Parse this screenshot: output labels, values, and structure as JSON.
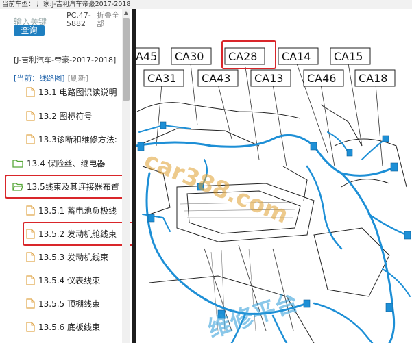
{
  "header": {
    "breadcrumb": "当前车型： 厂家:J-吉利汽车帝豪2017-2018"
  },
  "search": {
    "placeholder": "输入关键",
    "button_label": "查询"
  },
  "pc_code": "PC.47-5882",
  "collapse_label": "折叠全部",
  "car_title": "[J-吉利汽车-帝豪-2017-2018]",
  "current_label": "[当前：线路图]",
  "refresh_label": "[刷新]",
  "tree": [
    {
      "label": "13.1 电路图识读说明",
      "icon": "document-icon"
    },
    {
      "label": "13.2 图标符号",
      "icon": "document-icon"
    },
    {
      "label": "13.3诊断和维修方法:",
      "icon": "document-icon"
    },
    {
      "label": "13.4 保险丝、继电器",
      "icon": "folder-icon"
    },
    {
      "label": "13.5线束及其连接器布置",
      "icon": "folder-icon"
    },
    {
      "label": "13.5.1 蓄电池负极线",
      "icon": "document-icon"
    },
    {
      "label": "13.5.2 发动机舱线束",
      "icon": "document-icon"
    },
    {
      "label": "13.5.3 发动机线束",
      "icon": "document-icon"
    },
    {
      "label": "13.5.4 仪表线束",
      "icon": "document-icon"
    },
    {
      "label": "13.5.5 顶棚线束",
      "icon": "document-icon"
    },
    {
      "label": "13.5.6 底板线束",
      "icon": "document-icon"
    }
  ],
  "diagram": {
    "connectors_top": [
      "A45",
      "CA30",
      "CA28",
      "CA14",
      "CA15"
    ],
    "connectors_bottom": [
      "CA31",
      "CA43",
      "CA13",
      "CA46",
      "CA18"
    ],
    "watermark_1": "car388.com",
    "watermark_2": "维修平台",
    "harness_color": "#1d8fd6",
    "highlight_color": "#d9262a"
  }
}
